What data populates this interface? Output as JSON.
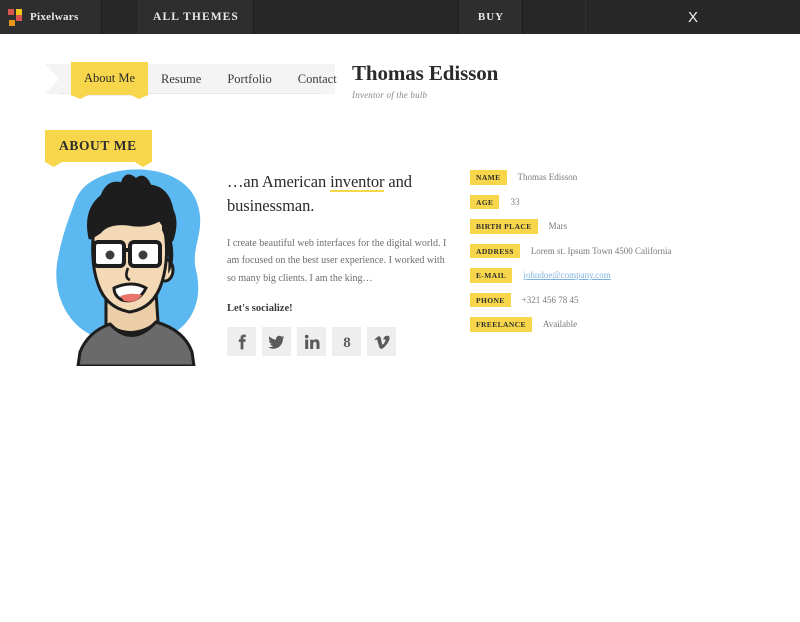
{
  "topbar": {
    "brand": "Pixelwars",
    "brand_icon": "pixelwars-logo-icon",
    "all_themes": "ALL THEMES",
    "buy": "BUY",
    "close": "X",
    "colors": {
      "background": "#272727",
      "panel": "#2e2e2e",
      "text": "#e9e9e9",
      "logo_red": "#d9534f",
      "logo_yellow": "#f0c419",
      "logo_orange": "#e8951d"
    }
  },
  "nav": {
    "items": [
      {
        "label": "About Me",
        "active": true
      },
      {
        "label": "Resume",
        "active": false
      },
      {
        "label": "Portfolio",
        "active": false
      },
      {
        "label": "Contact",
        "active": false
      }
    ]
  },
  "identity": {
    "name": "Thomas Edisson",
    "role": "Inventor of the bulb"
  },
  "section": {
    "banner_title": "ABOUT ME",
    "accent_color": "#f7d64b"
  },
  "avatar": {
    "alt": "Cartoon portrait of a young man with glasses and spiky black hair on a blue blob background",
    "blob_color": "#5cb8f0",
    "skin_color": "#f3d9b5",
    "hair_color": "#1d1d1d",
    "shirt_color": "#6a6a6a"
  },
  "bio": {
    "headline_before": "…an American ",
    "headline_highlight": "inventor",
    "headline_after": " and businessman.",
    "paragraph": "I create beautiful web interfaces for the digital world. I am focused on the best user experience. I worked with so many big clients. I am the king…",
    "socialize_label": "Let's socialize!",
    "social": [
      {
        "name": "facebook",
        "glyph": "f"
      },
      {
        "name": "twitter",
        "glyph": "t"
      },
      {
        "name": "linkedin",
        "glyph": "in"
      },
      {
        "name": "google-plus",
        "glyph": "g"
      },
      {
        "name": "vimeo",
        "glyph": "v"
      }
    ]
  },
  "info": {
    "rows": [
      {
        "key": "NAME",
        "value": "Thomas Edisson",
        "is_link": false
      },
      {
        "key": "AGE",
        "value": "33",
        "is_link": false
      },
      {
        "key": "BIRTH PLACE",
        "value": "Mars",
        "is_link": false
      },
      {
        "key": "ADDRESS",
        "value": "Lorem st. Ipsum Town 4500 California",
        "is_link": false
      },
      {
        "key": "E-MAIL",
        "value": "johndoe@company.com",
        "is_link": true
      },
      {
        "key": "PHONE",
        "value": "+321 456 78 45",
        "is_link": false
      },
      {
        "key": "FREELANCE",
        "value": "Available",
        "is_link": false
      }
    ]
  }
}
